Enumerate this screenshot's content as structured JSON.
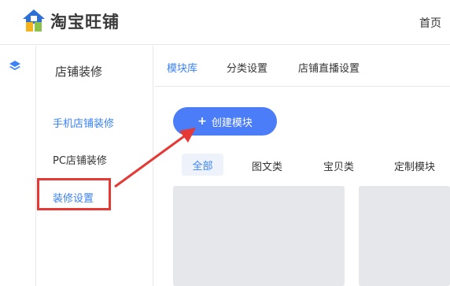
{
  "app": {
    "logo_text": "淘宝旺铺",
    "home_link": "首页"
  },
  "sidebar": {
    "title": "店铺装修",
    "items": [
      {
        "label": "手机店铺装修"
      },
      {
        "label": "PC店铺装修"
      },
      {
        "label": "装修设置"
      }
    ]
  },
  "tabs": [
    {
      "label": "模块库"
    },
    {
      "label": "分类设置"
    },
    {
      "label": "店铺直播设置"
    }
  ],
  "main": {
    "create_button": {
      "icon": "+",
      "label": "创建模块"
    },
    "filters": [
      {
        "label": "全部"
      },
      {
        "label": "图文类"
      },
      {
        "label": "宝贝类"
      },
      {
        "label": "定制模块"
      }
    ]
  },
  "colors": {
    "accent": "#4a7df7",
    "link_blue": "#3b82f6",
    "highlight_red": "#e53935",
    "card_gray": "#e6e7ea"
  }
}
